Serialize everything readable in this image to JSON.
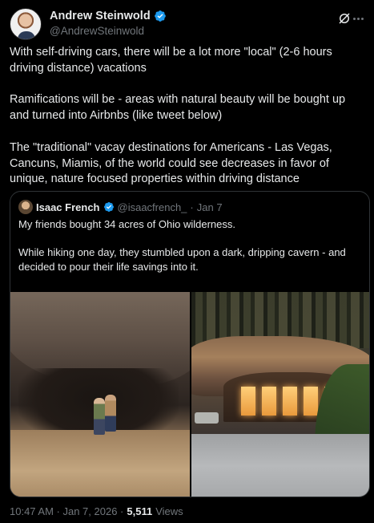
{
  "author": {
    "display_name": "Andrew Steinwold",
    "handle": "@AndrewSteinwold"
  },
  "post": {
    "paragraphs": [
      "With self-driving cars, there will be a lot more \"local\" (2-6 hours driving distance) vacations",
      "Ramifications will be - areas with natural beauty will be bought up and turned into Airbnbs (like tweet below)",
      "The \"traditional\" vacay destinations for Americans - Las Vegas, Cancuns, Miamis, of the world could see decreases in favor of unique, nature focused properties within driving distance"
    ]
  },
  "quoted": {
    "display_name": "Isaac French",
    "handle": "@isaacfrench_",
    "dot": "·",
    "date": "Jan 7",
    "paragraphs": [
      "My friends bought 34 acres of Ohio wilderness.",
      "While hiking one day, they stumbled upon a dark, dripping cavern - and decided to pour their life savings into it.",
      "..."
    ]
  },
  "footer": {
    "time_date": "10:47 AM · Jan 7, 2026 ·",
    "views_count": "5,511",
    "views_label": "Views"
  },
  "colors": {
    "background": "#000000",
    "text": "#e7e9ea",
    "secondary": "#71767b",
    "verified": "#1d9bf0",
    "border": "#2f3336"
  },
  "icons": [
    "verified-badge-icon",
    "grok-icon",
    "more-icon"
  ]
}
